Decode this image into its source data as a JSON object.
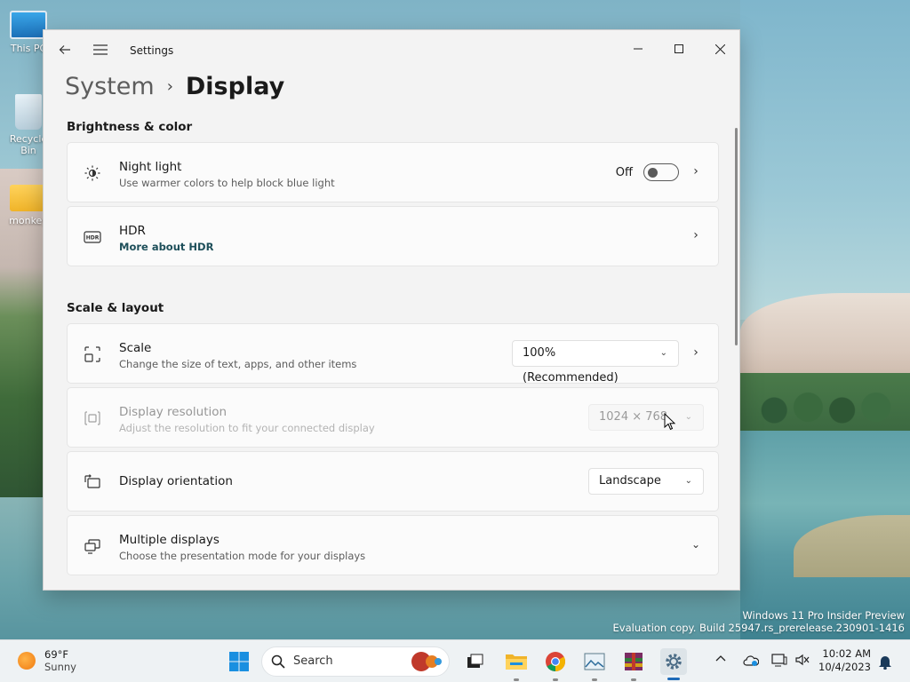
{
  "desktop": {
    "icons": [
      {
        "label": "This PC"
      },
      {
        "label": "Recycle Bin"
      },
      {
        "label": "monkey"
      }
    ],
    "watermark": {
      "line1": "Windows 11 Pro Insider Preview",
      "line2": "Evaluation copy. Build 25947.rs_prerelease.230901-1416"
    }
  },
  "window": {
    "app_title": "Settings",
    "breadcrumb": {
      "parent": "System",
      "separator": "›",
      "current": "Display"
    },
    "sections": [
      {
        "title": "Brightness & color",
        "items": [
          {
            "title": "Night light",
            "subtitle": "Use warmer colors to help block blue light",
            "toggle_state": "Off"
          },
          {
            "title": "HDR",
            "link": "More about HDR"
          }
        ]
      },
      {
        "title": "Scale & layout",
        "items": [
          {
            "title": "Scale",
            "subtitle": "Change the size of text, apps, and other items",
            "value": "100% (Recommended)"
          },
          {
            "title": "Display resolution",
            "subtitle": "Adjust the resolution to fit your connected display",
            "value": "1024 × 768"
          },
          {
            "title": "Display orientation",
            "value": "Landscape"
          },
          {
            "title": "Multiple displays",
            "subtitle": "Choose the presentation mode for your displays"
          }
        ]
      }
    ]
  },
  "taskbar": {
    "weather": {
      "temp": "69°F",
      "condition": "Sunny"
    },
    "search_label": "Search",
    "clock": {
      "time": "10:02 AM",
      "date": "10/4/2023"
    }
  },
  "colors": {
    "accent": "#1e4f5a",
    "window_bg": "#f3f3f3",
    "card_bg": "#fbfbfb"
  }
}
